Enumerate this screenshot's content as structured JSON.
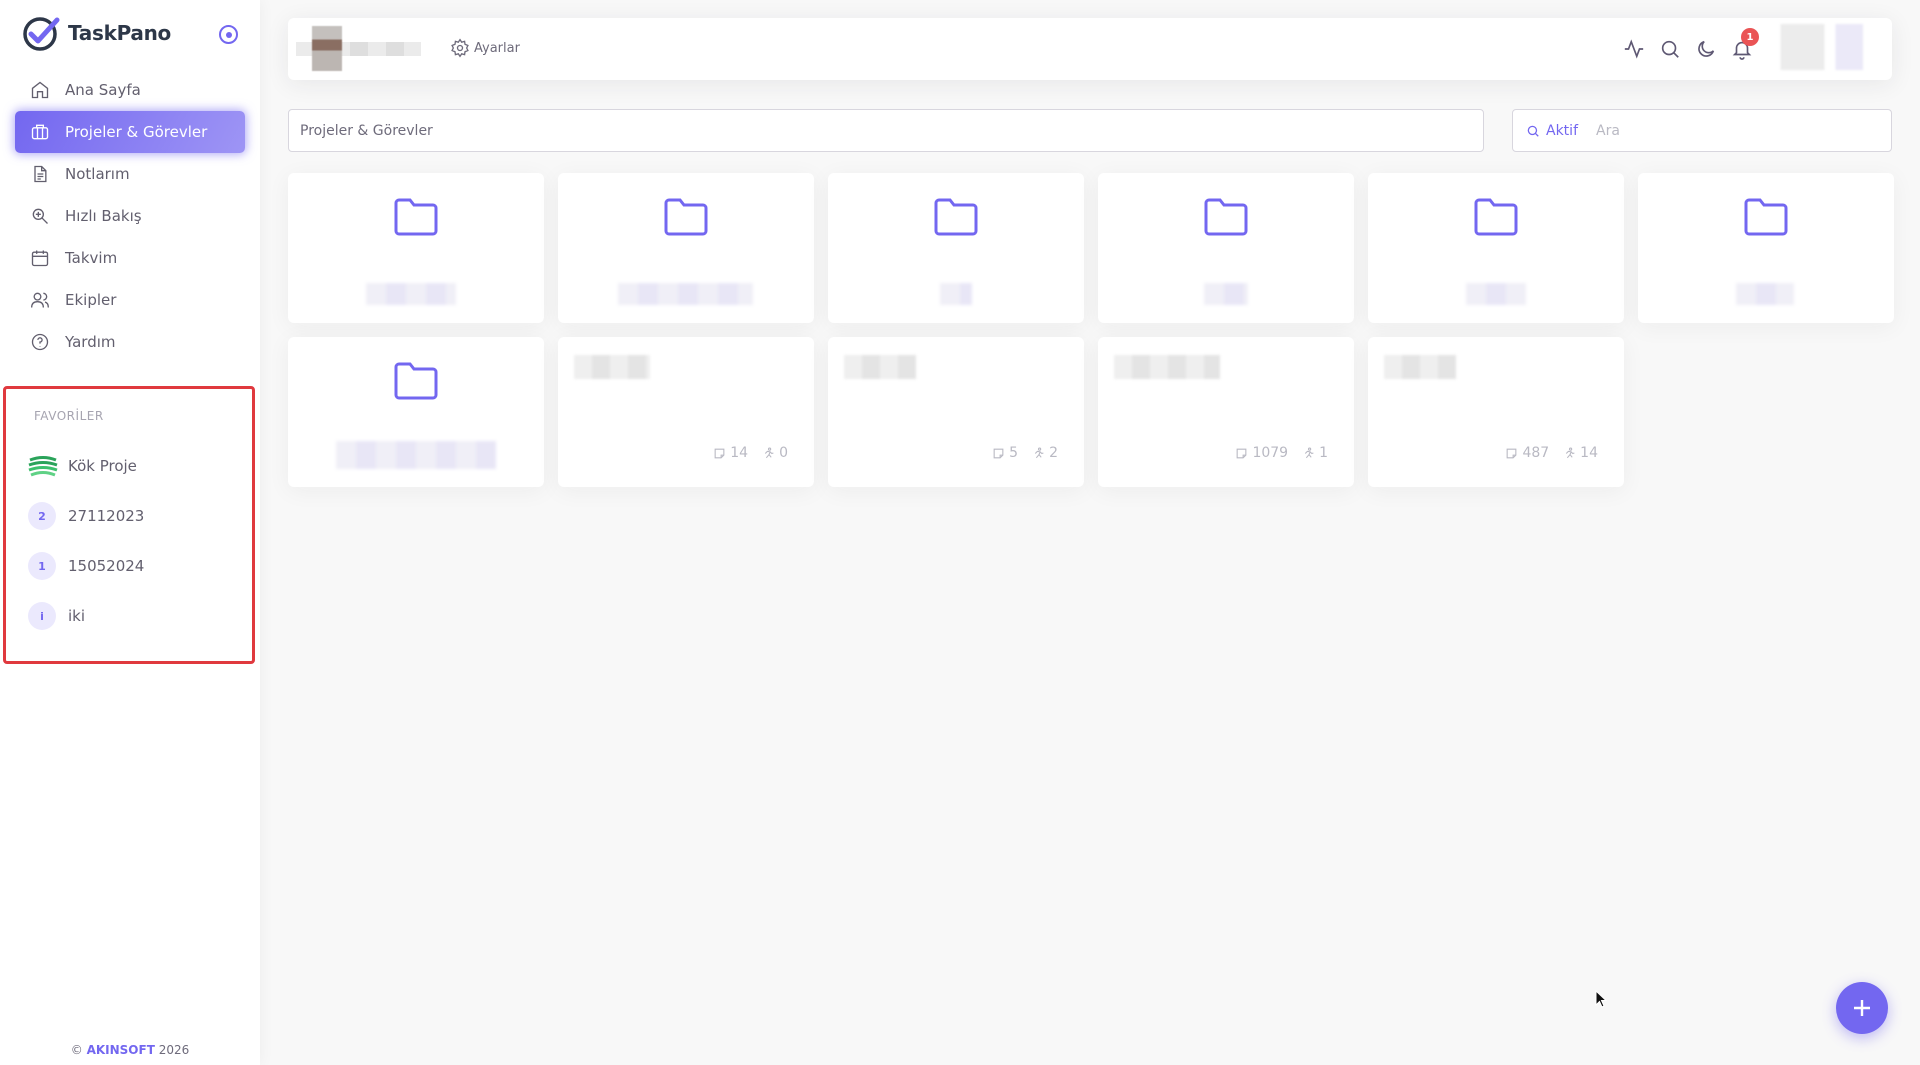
{
  "app": {
    "name": "TaskPano"
  },
  "sidebar": {
    "items": [
      {
        "label": "Ana Sayfa",
        "icon": "home-icon"
      },
      {
        "label": "Projeler & Görevler",
        "icon": "briefcase-icon",
        "active": true
      },
      {
        "label": "Notlarım",
        "icon": "document-icon"
      },
      {
        "label": "Hızlı Bakış",
        "icon": "zoom-icon"
      },
      {
        "label": "Takvim",
        "icon": "calendar-icon"
      },
      {
        "label": "Ekipler",
        "icon": "users-icon"
      },
      {
        "label": "Yardım",
        "icon": "help-icon"
      }
    ],
    "favorites_header": "FAVORİLER",
    "favorites": [
      {
        "label": "Kök Proje",
        "avatar": ""
      },
      {
        "label": "27112023",
        "avatar": "2"
      },
      {
        "label": "15052024",
        "avatar": "1"
      },
      {
        "label": "iki",
        "avatar": "i"
      }
    ],
    "footer": {
      "prefix": "©",
      "brand": "AKINSOFT",
      "year": "2026"
    }
  },
  "topbar": {
    "settings_label": "Ayarlar",
    "notification_count": "1",
    "icons": [
      "activity-icon",
      "search-icon",
      "moon-icon",
      "bell-icon"
    ]
  },
  "main": {
    "breadcrumb": "Projeler & Görevler",
    "search": {
      "filter_label": "Aktif",
      "placeholder": "Ara"
    },
    "task_cards": [
      {
        "notes": "14",
        "tasks": "0"
      },
      {
        "notes": "5",
        "tasks": "2"
      },
      {
        "notes": "1079",
        "tasks": "1"
      },
      {
        "notes": "487",
        "tasks": "14"
      }
    ]
  },
  "colors": {
    "accent": "#7367f0",
    "badge": "#ea5455",
    "highlight_border": "#e0393e"
  }
}
